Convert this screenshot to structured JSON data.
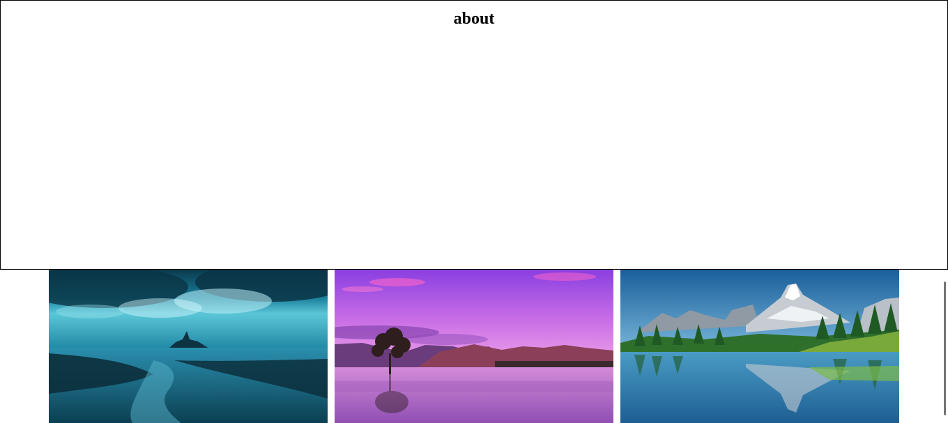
{
  "about": {
    "title": "about"
  },
  "gallery": {
    "images": [
      {
        "icon": "coastal-castle-landscape",
        "palette": {
          "sky": "#0d4b63",
          "water": "#0f6c86"
        }
      },
      {
        "icon": "lone-tree-lake-landscape",
        "palette": {
          "sky": "#b35bd9",
          "water": "#b86ac8"
        }
      },
      {
        "icon": "alpine-lake-landscape",
        "palette": {
          "sky": "#1f6fae",
          "water": "#2a78a8"
        }
      }
    ]
  }
}
